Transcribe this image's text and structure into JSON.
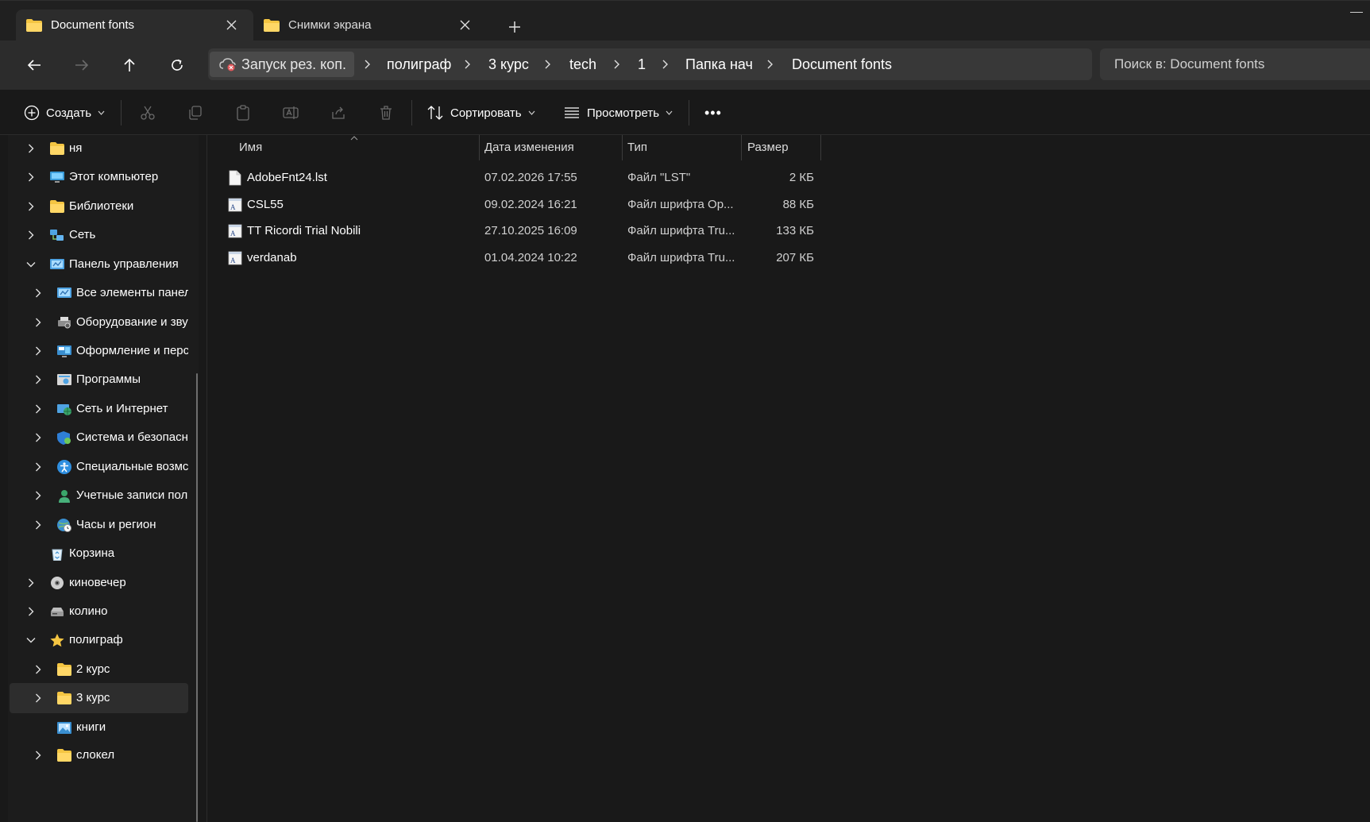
{
  "tabs": [
    {
      "label": "Document fonts",
      "active": true
    },
    {
      "label": "Снимки экрана",
      "active": false
    }
  ],
  "address": {
    "crumbs": [
      "Запуск рез. коп.",
      "полиграф",
      "3 курс",
      "tech",
      "1",
      "Папка нач",
      "Document fonts"
    ]
  },
  "search": {
    "placeholder": "Поиск в: Document fonts"
  },
  "toolbar": {
    "create_label": "Создать",
    "sort_label": "Сортировать",
    "view_label": "Просмотреть",
    "more_label": "•••"
  },
  "sidebar": {
    "items": [
      {
        "label": "ня",
        "icon": "folder-icon",
        "level": 0,
        "expander": "collapsed"
      },
      {
        "label": "Этот компьютер",
        "icon": "computer-icon",
        "level": 0,
        "expander": "collapsed"
      },
      {
        "label": "Библиотеки",
        "icon": "folder-icon",
        "level": 0,
        "expander": "collapsed"
      },
      {
        "label": "Сеть",
        "icon": "network-icon",
        "level": 0,
        "expander": "collapsed"
      },
      {
        "label": "Панель управления",
        "icon": "control-panel-icon",
        "level": 0,
        "expander": "expanded"
      },
      {
        "label": "Все элементы панел",
        "icon": "control-panel-icon",
        "level": 1,
        "expander": "collapsed"
      },
      {
        "label": "Оборудование и зву",
        "icon": "printer-icon",
        "level": 1,
        "expander": "collapsed"
      },
      {
        "label": "Оформление и перс",
        "icon": "display-icon",
        "level": 1,
        "expander": "collapsed"
      },
      {
        "label": "Программы",
        "icon": "programs-icon",
        "level": 1,
        "expander": "collapsed"
      },
      {
        "label": "Сеть и Интернет",
        "icon": "network-globe-icon",
        "level": 1,
        "expander": "collapsed"
      },
      {
        "label": "Система и безопасн",
        "icon": "shield-icon",
        "level": 1,
        "expander": "collapsed"
      },
      {
        "label": "Специальные возмс",
        "icon": "accessibility-icon",
        "level": 1,
        "expander": "collapsed"
      },
      {
        "label": "Учетные записи пол",
        "icon": "user-icon",
        "level": 1,
        "expander": "collapsed"
      },
      {
        "label": "Часы и регион",
        "icon": "clock-globe-icon",
        "level": 1,
        "expander": "collapsed"
      },
      {
        "label": "Корзина",
        "icon": "recycle-bin-icon",
        "level": 0,
        "expander": "none"
      },
      {
        "label": "киновечер",
        "icon": "disc-icon",
        "level": 0,
        "expander": "collapsed"
      },
      {
        "label": "колино",
        "icon": "drive-icon",
        "level": 0,
        "expander": "collapsed"
      },
      {
        "label": "полиграф",
        "icon": "star-icon",
        "level": 0,
        "expander": "expanded"
      },
      {
        "label": "2 курс",
        "icon": "folder-icon",
        "level": 1,
        "expander": "collapsed"
      },
      {
        "label": "3 курс",
        "icon": "folder-icon",
        "level": 1,
        "expander": "collapsed",
        "selected": true
      },
      {
        "label": "книги",
        "icon": "picture-icon",
        "level": 1,
        "expander": "none"
      },
      {
        "label": "слокел",
        "icon": "folder-icon",
        "level": 1,
        "expander": "collapsed"
      }
    ]
  },
  "columns": {
    "name": "Имя",
    "date": "Дата изменения",
    "type": "Тип",
    "size": "Размер"
  },
  "files": [
    {
      "name": "AdobeFnt24.lst",
      "date": "07.02.2026 17:55",
      "type": "Файл \"LST\"",
      "size": "2 КБ",
      "icon": "document-icon"
    },
    {
      "name": "CSL55",
      "date": "09.02.2024 16:21",
      "type": "Файл шрифта Op...",
      "size": "88 КБ",
      "icon": "font-file-icon"
    },
    {
      "name": "TT Ricordi Trial Nobili",
      "date": "27.10.2025 16:09",
      "type": "Файл шрифта Tru...",
      "size": "133 КБ",
      "icon": "font-file-icon"
    },
    {
      "name": "verdanab",
      "date": "01.04.2024 10:22",
      "type": "Файл шрифта Tru...",
      "size": "207 КБ",
      "icon": "font-file-icon"
    }
  ],
  "colors": {
    "folder": "#f4c542",
    "accent_blue": "#4fa3e3",
    "background": "#191919",
    "chrome": "#2c2c2c"
  }
}
